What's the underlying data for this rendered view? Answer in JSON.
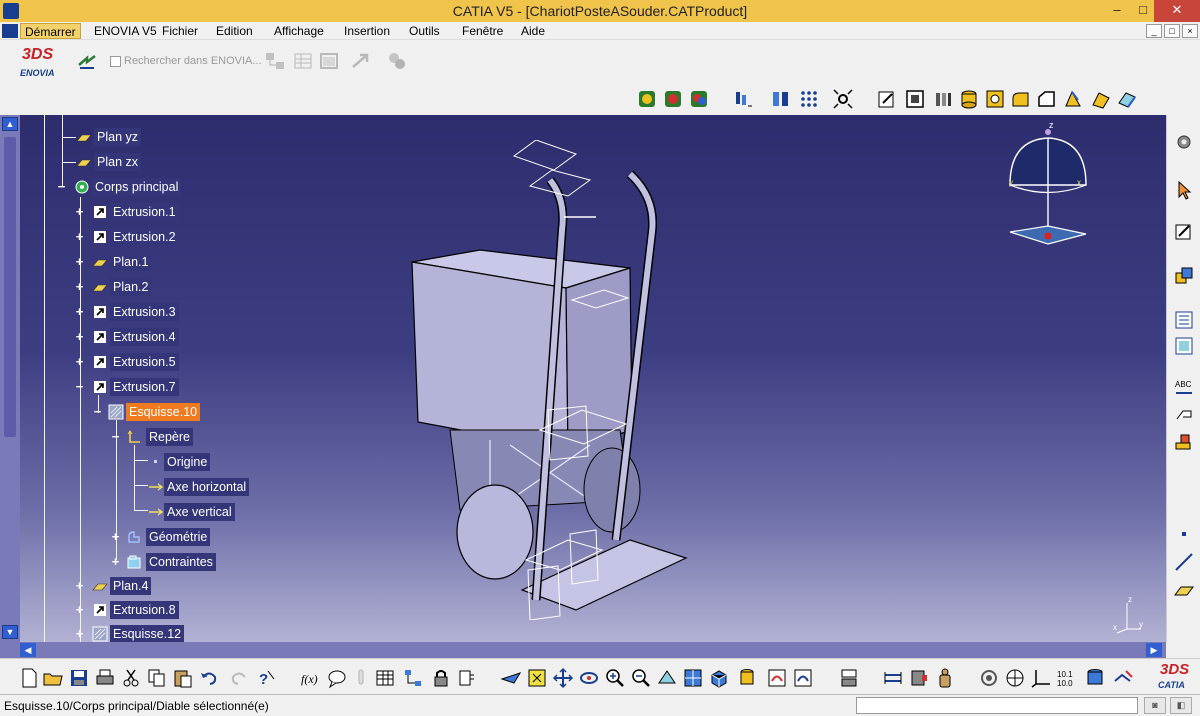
{
  "window": {
    "title": "CATIA V5 - [ChariotPosteASouder.CATProduct]",
    "minimize": "‒",
    "maximize": "□",
    "close": "✕"
  },
  "menu": {
    "items": [
      "Démarrer",
      "ENOVIA V5",
      "Fichier",
      "Edition",
      "Affichage",
      "Insertion",
      "Outils",
      "Fenêtre",
      "Aide"
    ],
    "mdi": [
      "_",
      "□",
      "×"
    ]
  },
  "toolbar_top": {
    "logo_label": "ENOVIA",
    "logo_mark": "3DS",
    "search_label": "Rechercher dans ENOVIA..."
  },
  "tree": {
    "nodes": [
      {
        "label": "Plan yz",
        "icon": "plane-icon",
        "selected": false
      },
      {
        "label": "Plan zx",
        "icon": "plane-icon",
        "selected": false
      },
      {
        "label": "Corps principal",
        "icon": "body-gear-icon",
        "selected": false
      },
      {
        "label": "Extrusion.1",
        "icon": "pad-icon",
        "selected": false
      },
      {
        "label": "Extrusion.2",
        "icon": "pad-icon",
        "selected": false
      },
      {
        "label": "Plan.1",
        "icon": "plane-icon",
        "selected": false
      },
      {
        "label": "Plan.2",
        "icon": "plane-icon",
        "selected": false
      },
      {
        "label": "Extrusion.3",
        "icon": "pad-icon",
        "selected": false
      },
      {
        "label": "Extrusion.4",
        "icon": "pad-icon",
        "selected": false
      },
      {
        "label": "Extrusion.5",
        "icon": "pad-icon",
        "selected": false
      },
      {
        "label": "Extrusion.7",
        "icon": "pad-icon",
        "selected": false
      },
      {
        "label": "Esquisse.10",
        "icon": "sketch-icon",
        "selected": true
      },
      {
        "label": "Repère",
        "icon": "axis-system-icon",
        "selected": false
      },
      {
        "label": "Origine",
        "icon": "point-icon",
        "selected": false
      },
      {
        "label": "Axe horizontal",
        "icon": "axis-arrow-icon",
        "selected": false
      },
      {
        "label": "Axe vertical",
        "icon": "axis-arrow-icon",
        "selected": false
      },
      {
        "label": "Géométrie",
        "icon": "geometry-icon",
        "selected": false
      },
      {
        "label": "Contraintes",
        "icon": "constraints-icon",
        "selected": false
      },
      {
        "label": "Plan.4",
        "icon": "plane-icon",
        "selected": false
      },
      {
        "label": "Extrusion.8",
        "icon": "pad-icon",
        "selected": false
      },
      {
        "label": "Esquisse.12",
        "icon": "sketch-icon",
        "selected": false
      }
    ]
  },
  "compass": {
    "axis_z": "z",
    "axis_x": "x",
    "axis_y": "y"
  },
  "axes": {
    "z": "z",
    "x": "x",
    "y": "y"
  },
  "bottom_toolbar": {
    "logo_mark": "3DS",
    "logo_label": "CATIA",
    "measure_label": "10.1\n10.0"
  },
  "statusbar": {
    "message": "Esquisse.10/Corps principal/Diable sélectionné(e)"
  },
  "colors": {
    "titlebar": "#f0c34b",
    "viewport_top": "#2d2d6e",
    "viewport_bottom": "#b2b2d4",
    "selection": "#f07b1f",
    "tree_label_bg": "#35357a"
  }
}
